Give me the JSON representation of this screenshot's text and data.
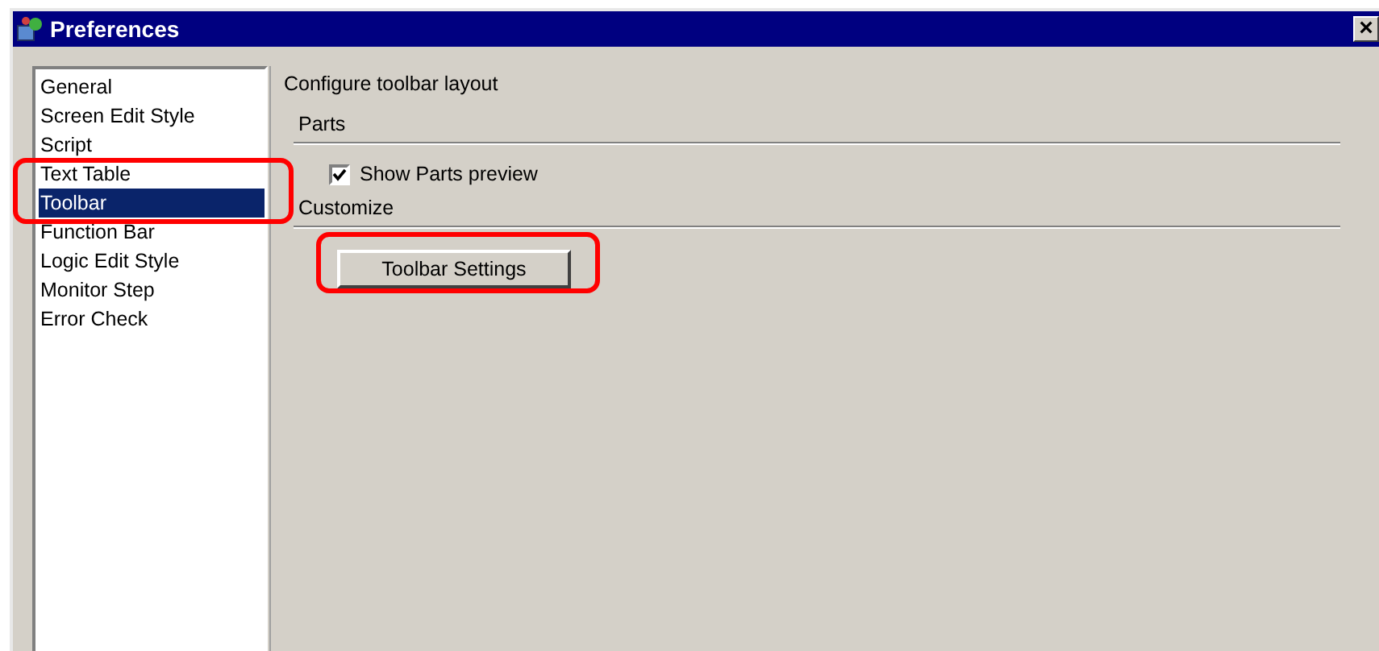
{
  "window": {
    "title": "Preferences",
    "close": "×"
  },
  "sidebar": {
    "items": [
      {
        "label": "General",
        "selected": false
      },
      {
        "label": "Screen Edit Style",
        "selected": false
      },
      {
        "label": "Script",
        "selected": false
      },
      {
        "label": "Text Table",
        "selected": false
      },
      {
        "label": "Toolbar",
        "selected": true,
        "highlighted": true
      },
      {
        "label": "Function Bar",
        "selected": false
      },
      {
        "label": "Logic Edit Style",
        "selected": false
      },
      {
        "label": "Monitor Step",
        "selected": false
      },
      {
        "label": "Error Check",
        "selected": false
      }
    ]
  },
  "panel": {
    "heading": "Configure toolbar layout",
    "groups": [
      {
        "title": "Parts",
        "controls": [
          {
            "kind": "checkbox",
            "label": "Show Parts preview",
            "checked": true
          }
        ]
      },
      {
        "title": "Customize",
        "controls": [
          {
            "kind": "button",
            "label": "Toolbar Settings",
            "highlighted": true
          }
        ]
      }
    ]
  }
}
